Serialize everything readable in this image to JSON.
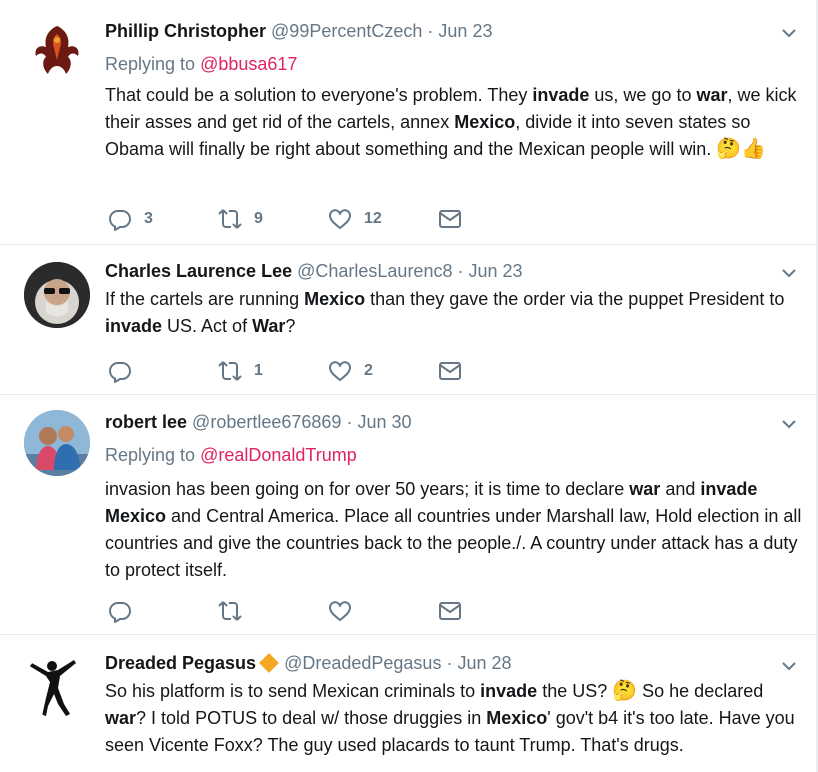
{
  "tweets": [
    {
      "name": "Phillip Christopher",
      "handle": "@99PercentCzech",
      "sep": "·",
      "time": "Jun 23",
      "replying_prefix": "Replying to",
      "replying_to": "@bbusa617",
      "text_parts": [
        "That could be a solution to everyone's problem. They ",
        "invade",
        " us, we go to ",
        "war",
        ", we kick their asses and get rid of the cartels, annex ",
        "Mexico",
        ", divide it into seven states so Obama will finally be right about something and the Mexican people will win. "
      ],
      "emoji": "🤔👍",
      "replies": "3",
      "retweets": "9",
      "likes": "12"
    },
    {
      "name": "Charles Laurence Lee",
      "handle": "@CharlesLaurenc8",
      "sep": "·",
      "time": "Jun 23",
      "text_parts": [
        "If the cartels are running ",
        "Mexico",
        " than they gave the order via the puppet President to ",
        "invade",
        " US. Act of ",
        "War",
        "?"
      ],
      "replies": "",
      "retweets": "1",
      "likes": "2"
    },
    {
      "name": "robert lee",
      "handle": "@robertlee676869",
      "sep": "·",
      "time": "Jun 30",
      "replying_prefix": "Replying to",
      "replying_to": "@realDonaldTrump",
      "text_parts": [
        "invasion has been going on for over 50 years; it is time to declare ",
        "war",
        " and ",
        "invade",
        " ",
        "Mexico",
        " and Central America. Place all countries under Marshall law, Hold election in all countries and give the countries back to the people./. A country under attack has a duty to protect itself."
      ],
      "replies": "",
      "retweets": "",
      "likes": ""
    },
    {
      "name": "Dreaded Pegasus",
      "handle": "@DreadedPegasus",
      "sep": "·",
      "time": "Jun 28",
      "text_parts": [
        "So his platform is to send Mexican criminals to ",
        "invade",
        " the US? ",
        "🤔",
        " So he declared ",
        "war",
        "? I told POTUS to deal w/ those druggies in ",
        "Mexico",
        "' gov't b4 it's too late. Have you seen Vicente Foxx? The guy used placards to taunt Trump. That's drugs."
      ]
    }
  ],
  "colors": {
    "accent_mention": "#e0245e",
    "muted": "#657786",
    "badge": "#f5a623"
  },
  "icons": [
    "reply-icon",
    "retweet-icon",
    "like-icon",
    "direct-message-icon",
    "chevron-down-icon",
    "verified-badge-icon"
  ]
}
